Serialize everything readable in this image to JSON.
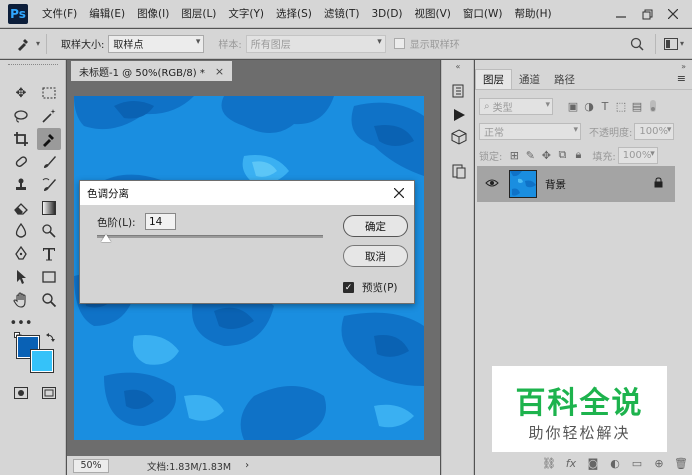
{
  "app": {
    "logo": "Ps"
  },
  "menu": {
    "items": [
      "文件(F)",
      "编辑(E)",
      "图像(I)",
      "图层(L)",
      "文字(Y)",
      "选择(S)",
      "滤镜(T)",
      "3D(D)",
      "视图(V)",
      "窗口(W)",
      "帮助(H)"
    ]
  },
  "options_bar": {
    "sample_size_label": "取样大小:",
    "sample_size_value": "取样点",
    "sample_label": "样本:",
    "sample_value": "所有图层",
    "show_ring_label": "显示取样环"
  },
  "document": {
    "tab_title": "未标题-1 @ 50%(RGB/8) *",
    "tab_close": "×",
    "zoom": "50%",
    "doc_info": "文档:1.83M/1.83M"
  },
  "colors": {
    "foreground": "#0961b5",
    "background": "#35c2f9",
    "canvas_base": "#1a8ee0"
  },
  "layers_panel": {
    "tabs": [
      "图层",
      "通道",
      "路径"
    ],
    "active_tab": "图层",
    "filter_kind": "类型",
    "blend_mode": "正常",
    "opacity_label": "不透明度:",
    "opacity_value": "100%",
    "lock_label": "锁定:",
    "fill_label": "填充:",
    "fill_value": "100%",
    "layer_name": "背景"
  },
  "dialog": {
    "title": "色调分离",
    "levels_label": "色阶(L):",
    "levels_value": "14",
    "levels_slider": 0.04,
    "ok_label": "确定",
    "cancel_label": "取消",
    "preview_label": "预览(P)",
    "preview_checked": true
  },
  "watermark": {
    "main_text": "百科全说",
    "sub_text": "助你轻松解决"
  }
}
